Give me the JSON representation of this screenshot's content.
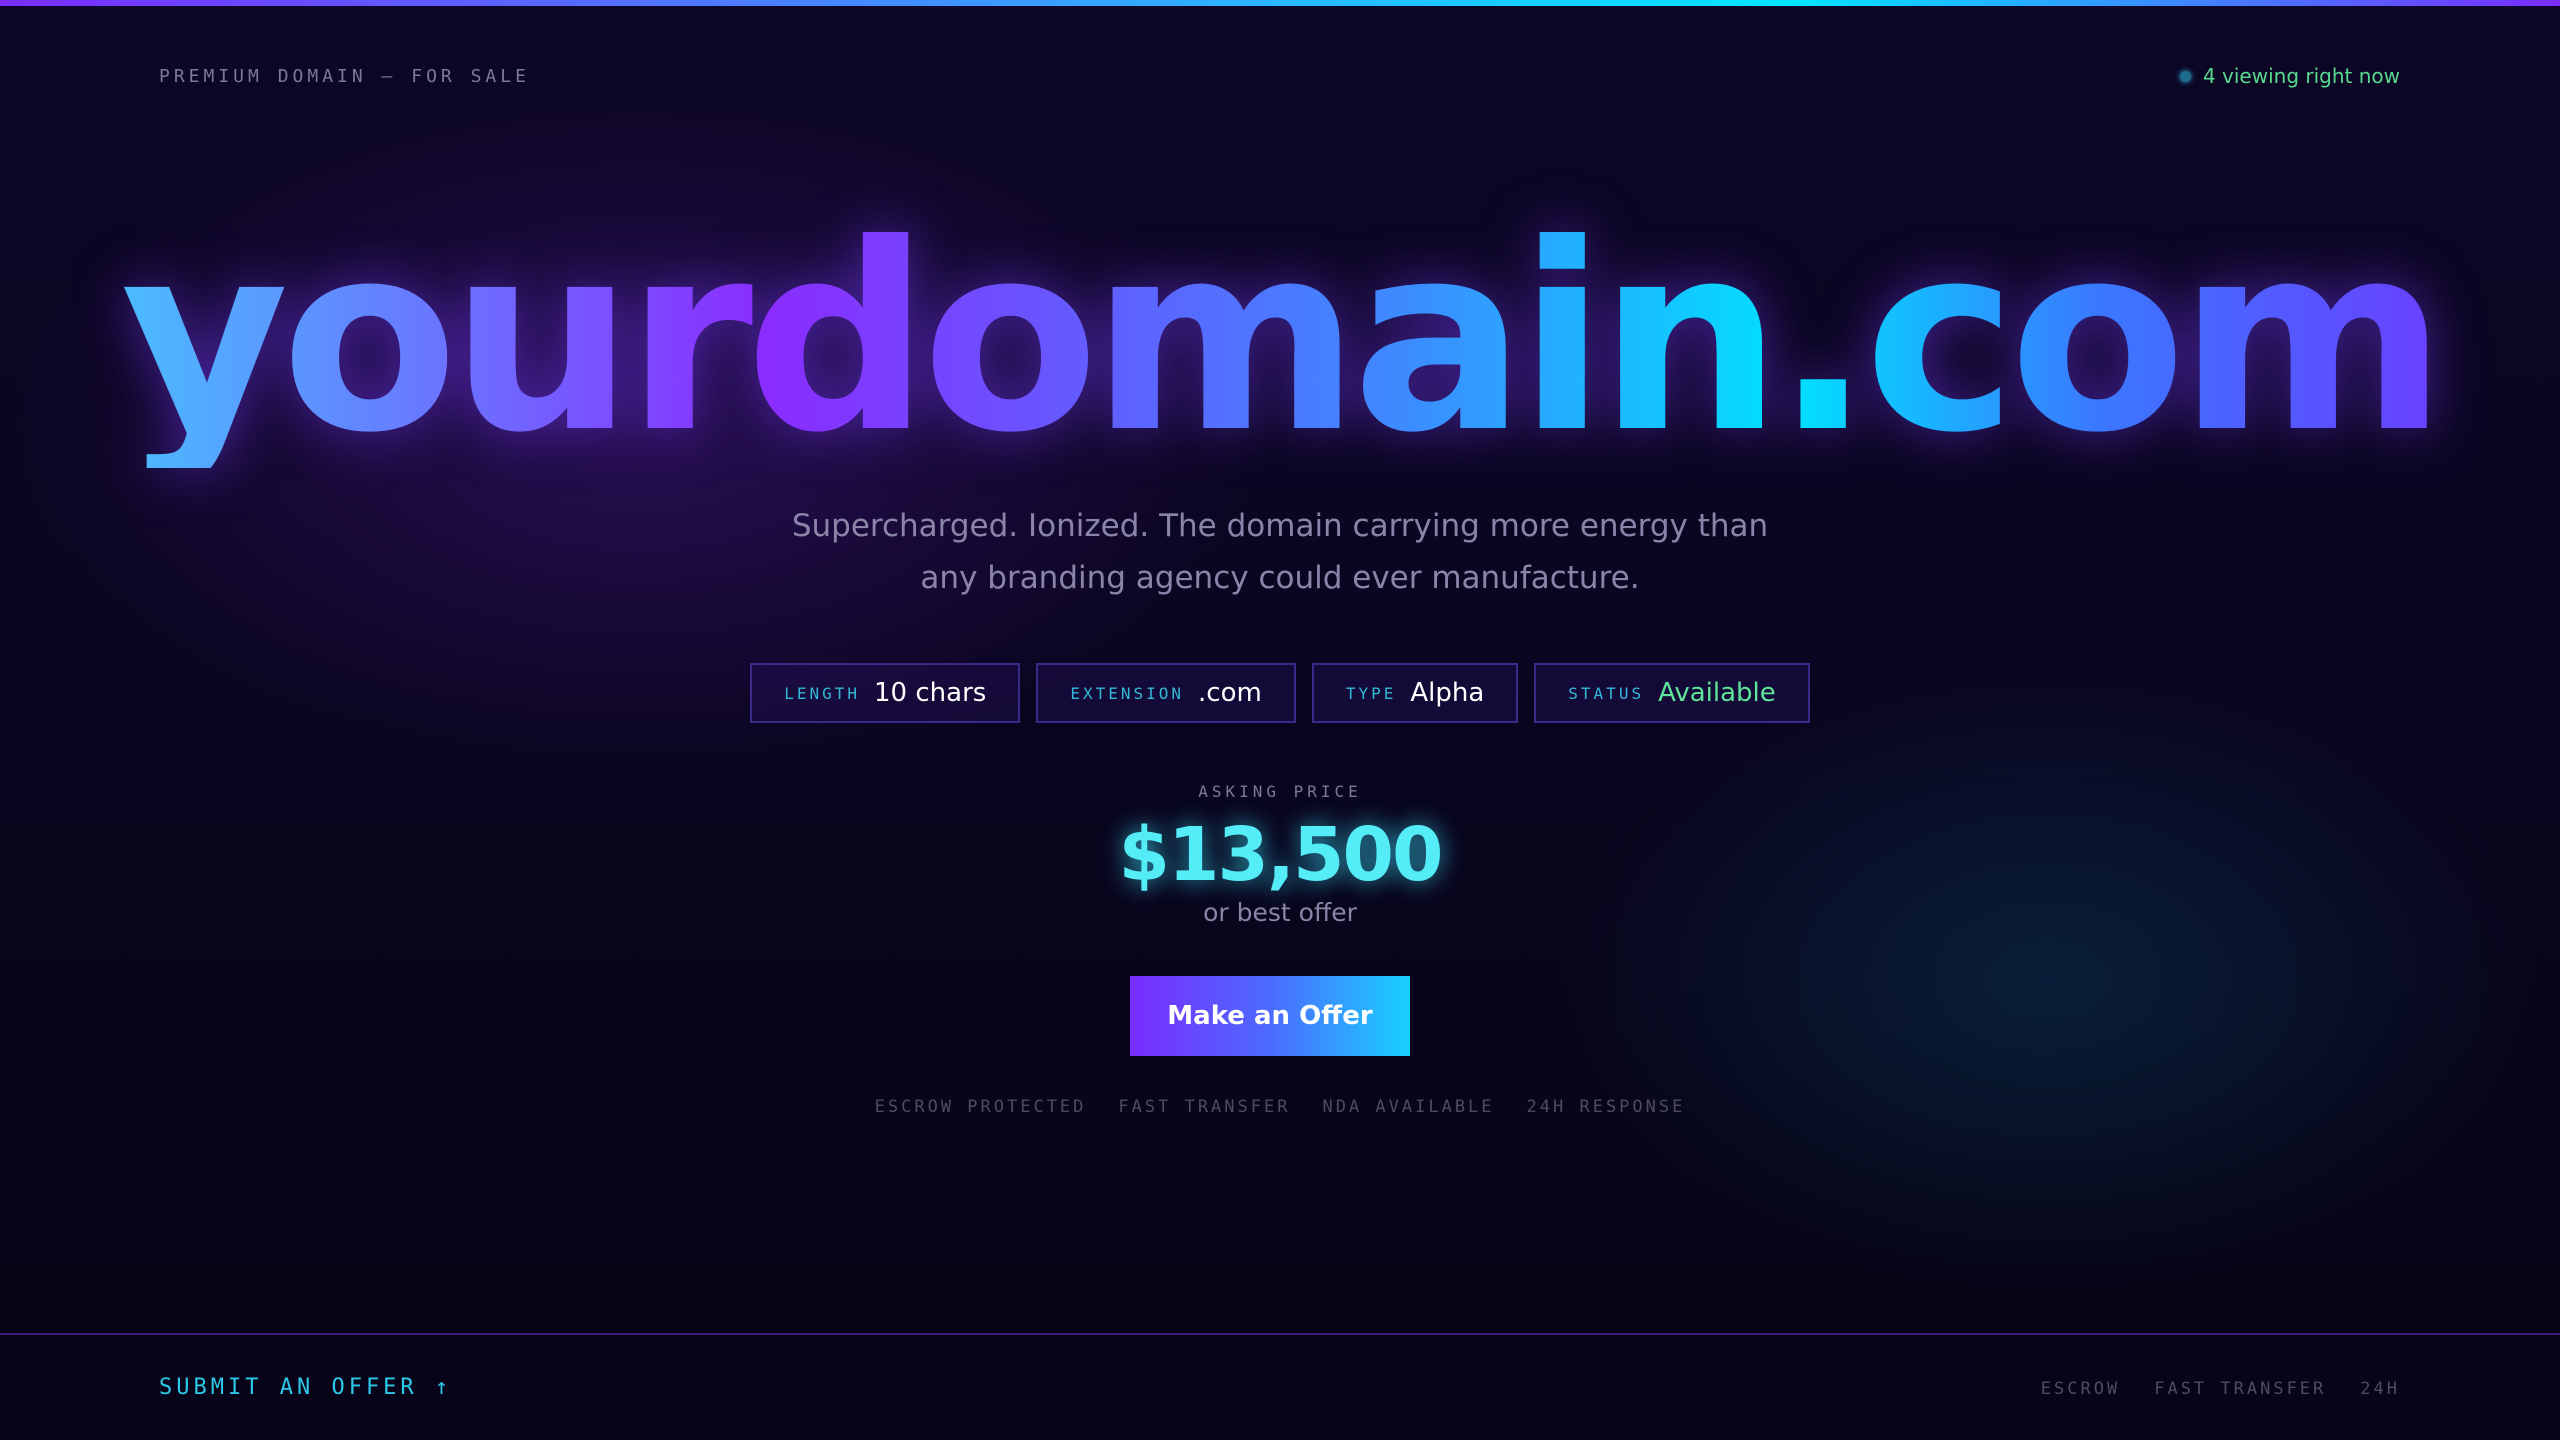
{
  "header": {
    "label": "PREMIUM DOMAIN — FOR SALE",
    "viewing": "4 viewing right now"
  },
  "hero": {
    "domain": "yourdomain.com",
    "tagline": "Supercharged. Ionized. The domain carrying more energy than any branding agency could ever manufacture."
  },
  "chips": [
    {
      "key": "LENGTH",
      "value": "10 chars"
    },
    {
      "key": "EXTENSION",
      "value": ".com"
    },
    {
      "key": "TYPE",
      "value": "Alpha"
    },
    {
      "key": "STATUS",
      "value": "Available"
    }
  ],
  "pricing": {
    "label": "ASKING PRICE",
    "price": "$13,500",
    "note": "or best offer"
  },
  "cta": {
    "label": "Make an Offer"
  },
  "features": [
    "ESCROW PROTECTED",
    "FAST TRANSFER",
    "NDA AVAILABLE",
    "24H RESPONSE"
  ],
  "footer": {
    "submit_label": "SUBMIT AN OFFER ↑",
    "items": [
      "ESCROW",
      "FAST TRANSFER",
      "24H"
    ]
  },
  "colors": {
    "accent_cyan": "#00e1ff",
    "accent_purple": "#7a2cff",
    "status_green": "#5ee39a"
  },
  "icons": {
    "live_indicator": "live-dot-icon",
    "submit_arrow": "arrow-up-icon"
  }
}
